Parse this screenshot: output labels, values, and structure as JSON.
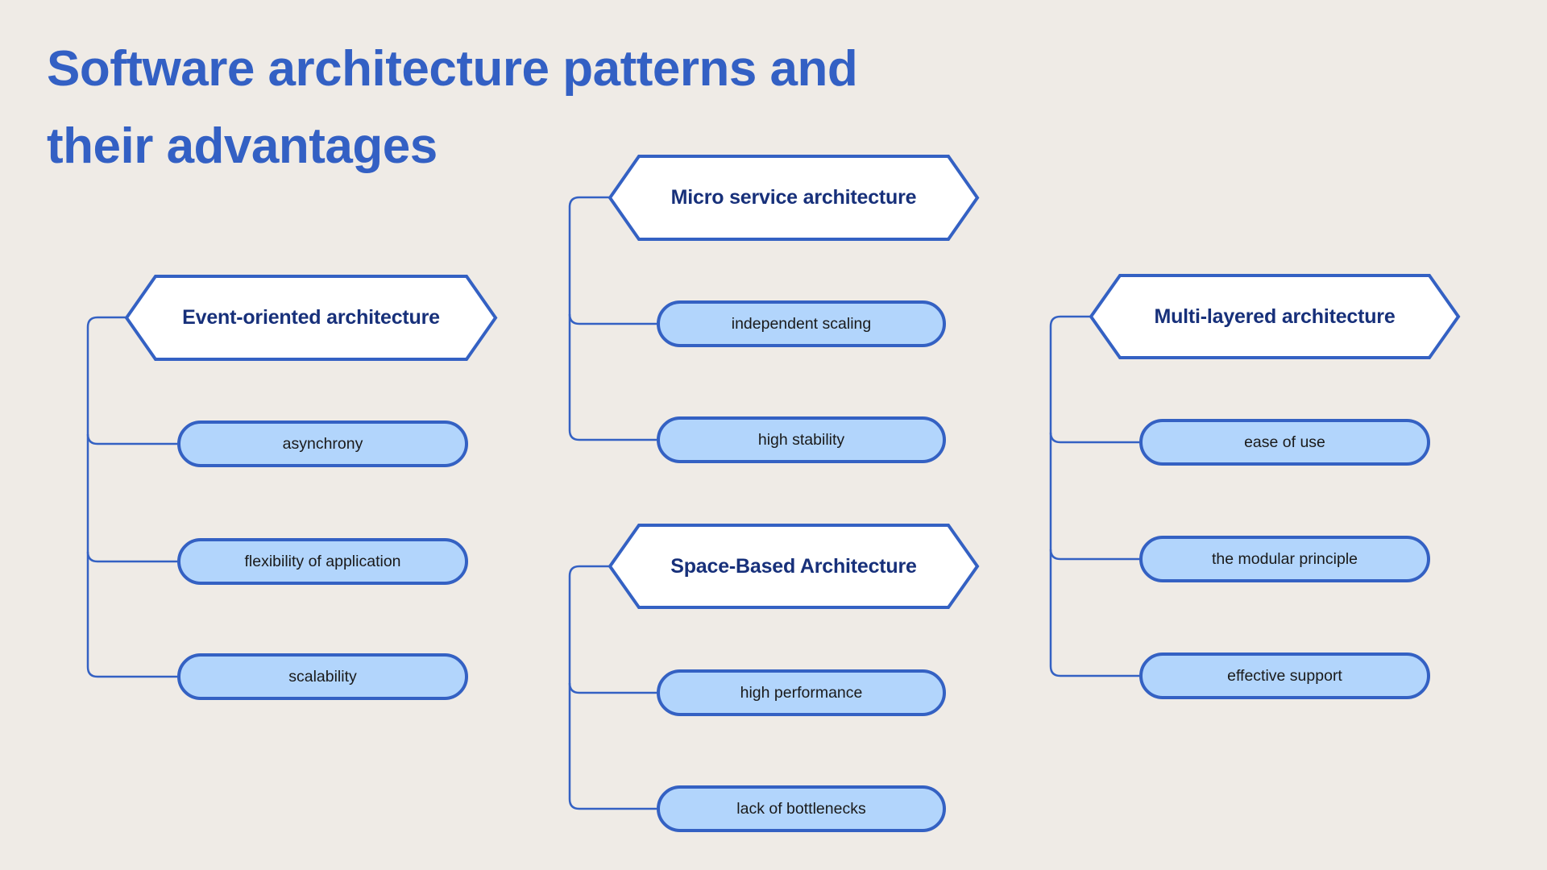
{
  "title": {
    "line1": "Software architecture patterns and",
    "line2": "their advantages"
  },
  "colors": {
    "background": "#EFEBE6",
    "accent": "#3461C3",
    "title": "#3360C4",
    "heading_text": "#17307A",
    "pill_fill": "#B2D5FC",
    "hex_fill": "#FFFFFF",
    "pill_text": "#1A1A1A"
  },
  "groups": [
    {
      "id": "event-oriented",
      "label": "Event-oriented architecture",
      "advantages": [
        "asynchrony",
        "flexibility of application",
        "scalability"
      ]
    },
    {
      "id": "micro-service",
      "label": "Micro service architecture",
      "advantages": [
        "independent scaling",
        "high stability"
      ]
    },
    {
      "id": "space-based",
      "label": "Space-Based Architecture",
      "advantages": [
        "high performance",
        "lack of bottlenecks"
      ]
    },
    {
      "id": "multi-layered",
      "label": "Multi-layered architecture",
      "advantages": [
        "ease of use",
        "the modular principle",
        "effective support"
      ]
    }
  ]
}
